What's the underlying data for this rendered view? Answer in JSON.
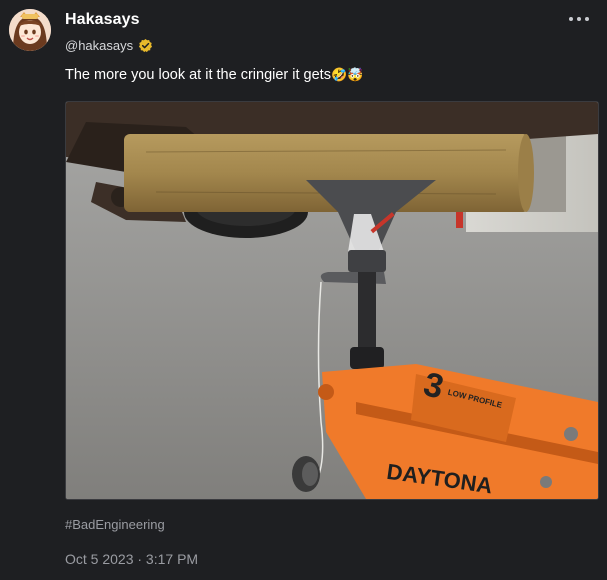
{
  "author": {
    "display_name": "Hakasays",
    "handle": "@hakasays",
    "verified": true,
    "avatar_icon": "anime-avatar"
  },
  "post": {
    "text": "The more you look at it the cringier it gets",
    "emojis": "🤣🤯",
    "hashtag": "#BadEngineering",
    "timestamp": "Oct 5 2023 · 3:17 PM"
  },
  "media": {
    "jack_brand": "DAYTONA",
    "jack_label_number": "3",
    "jack_label_text": "LOW PROFILE"
  },
  "colors": {
    "background": "#1e1f22",
    "verified_badge": "#e8b92b",
    "secondary_text": "#9a9ca2",
    "jack_orange": "#f07a2a"
  }
}
